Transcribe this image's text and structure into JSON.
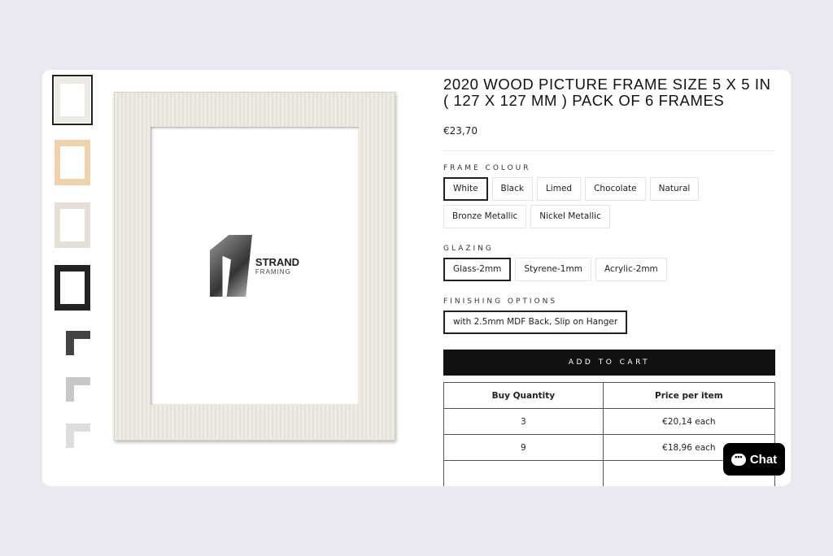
{
  "product": {
    "title": "2020 WOOD PICTURE FRAME SIZE 5 X 5 IN ( 127 X 127 MM ) PACK OF 6 FRAMES",
    "price": "€23,70"
  },
  "logo": {
    "line1": "STRAND",
    "line2": "FRAMING"
  },
  "frame_colour": {
    "label": "FRAME COLOUR",
    "options": [
      "White",
      "Black",
      "Limed",
      "Chocolate",
      "Natural",
      "Bronze Metallic",
      "Nickel Metallic"
    ],
    "selected": "White"
  },
  "glazing": {
    "label": "GLAZING",
    "options": [
      "Glass-2mm",
      "Styrene-1mm",
      "Acrylic-2mm"
    ],
    "selected": "Glass-2mm"
  },
  "finishing": {
    "label": "FINISHING OPTIONS",
    "options": [
      "with 2.5mm MDF Back, Slip on Hanger"
    ],
    "selected": "with 2.5mm MDF Back, Slip on Hanger"
  },
  "add_to_cart": "ADD TO CART",
  "pricing_table": {
    "headers": [
      "Buy Quantity",
      "Price per item"
    ],
    "rows": [
      [
        "3",
        "€20,14 each"
      ],
      [
        "9",
        "€18,96 each"
      ]
    ]
  },
  "chat": {
    "label": "Chat",
    "icon": "chat-bubble-icon"
  }
}
